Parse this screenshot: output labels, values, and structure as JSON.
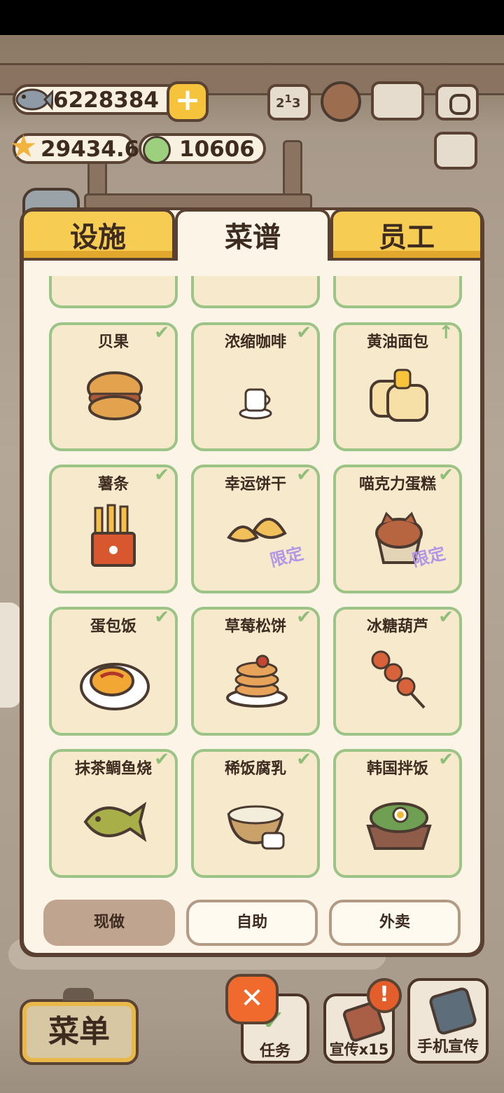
{
  "currency": {
    "fish": "6228384",
    "stars": "29434.6",
    "coins": "10606"
  },
  "tabs": [
    {
      "label": "设施",
      "active": false
    },
    {
      "label": "菜谱",
      "active": true
    },
    {
      "label": "员工",
      "active": false
    }
  ],
  "recipes": [
    {
      "name": "贝果",
      "icon": "bagel-icon",
      "mark": "✔",
      "limited": ""
    },
    {
      "name": "浓缩咖啡",
      "icon": "espresso-icon",
      "mark": "✔",
      "limited": ""
    },
    {
      "name": "黄油面包",
      "icon": "butter-toast-icon",
      "mark": "↑",
      "limited": ""
    },
    {
      "name": "薯条",
      "icon": "fries-icon",
      "mark": "✔",
      "limited": ""
    },
    {
      "name": "幸运饼干",
      "icon": "fortune-cookie-icon",
      "mark": "✔",
      "limited": "限定"
    },
    {
      "name": "喵克力蛋糕",
      "icon": "cat-cake-icon",
      "mark": "✔",
      "limited": "限定"
    },
    {
      "name": "蛋包饭",
      "icon": "omurice-icon",
      "mark": "✔",
      "limited": ""
    },
    {
      "name": "草莓松饼",
      "icon": "pancake-icon",
      "mark": "✔",
      "limited": ""
    },
    {
      "name": "冰糖葫芦",
      "icon": "tanghulu-icon",
      "mark": "✔",
      "limited": ""
    },
    {
      "name": "抹茶鲷鱼烧",
      "icon": "taiyaki-icon",
      "mark": "✔",
      "limited": ""
    },
    {
      "name": "稀饭腐乳",
      "icon": "congee-icon",
      "mark": "✔",
      "limited": ""
    },
    {
      "name": "韩国拌饭",
      "icon": "bibimbap-icon",
      "mark": "✔",
      "limited": ""
    }
  ],
  "filters": [
    {
      "label": "现做",
      "active": true
    },
    {
      "label": "自助",
      "active": false
    },
    {
      "label": "外卖",
      "active": false
    }
  ],
  "bottom": {
    "menu": "菜单",
    "close": "✕",
    "tasks": "任务",
    "promote": "宣传x15",
    "phone_promote": "手机宣传"
  }
}
